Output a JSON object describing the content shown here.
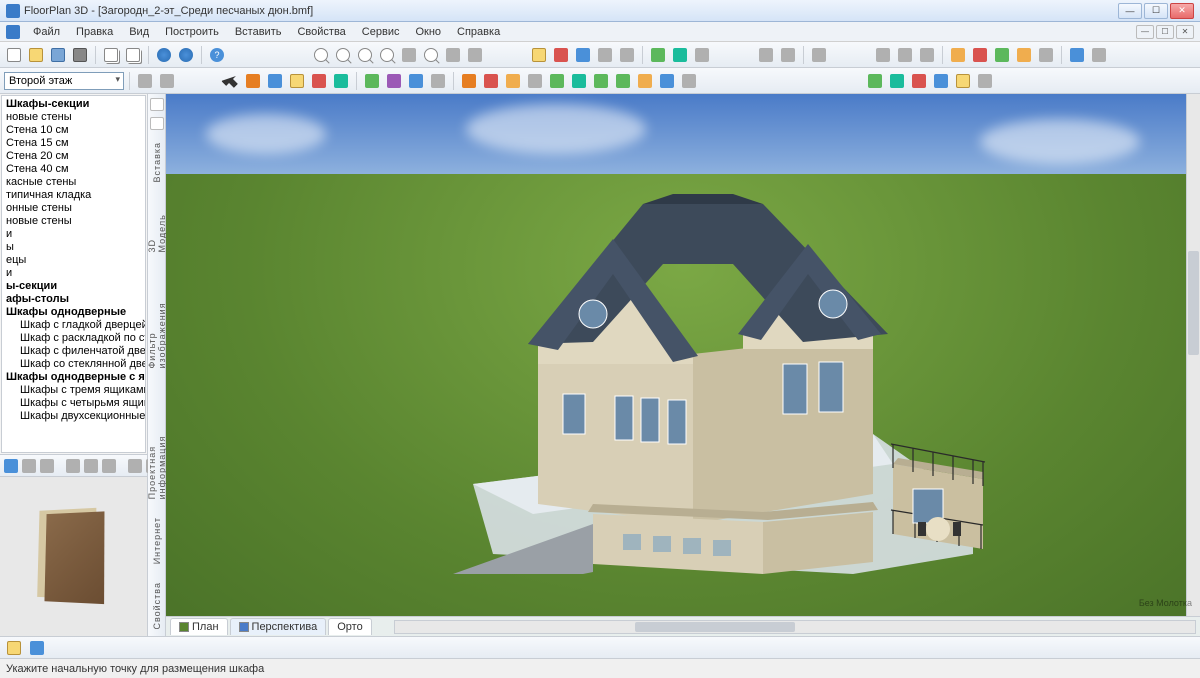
{
  "titlebar": {
    "title": "FloorPlan 3D - [Загородн_2-эт_Среди песчаных дюн.bmf]"
  },
  "menu": {
    "items": [
      "Файл",
      "Правка",
      "Вид",
      "Построить",
      "Вставить",
      "Свойства",
      "Сервис",
      "Окно",
      "Справка"
    ]
  },
  "floor_selector": {
    "value": "Второй этаж"
  },
  "sidebar_tree": {
    "items": [
      "Шкафы-секции",
      "новые стены",
      "Стена 10 см",
      "Стена 15 см",
      "Стена 20 см",
      "Стена 40 см",
      "касные стены",
      "типичная кладка",
      "онные стены",
      "новые стены",
      "и",
      "ы",
      "ецы",
      "и",
      "ы-секции",
      "афы-столы",
      "Шкафы однодверные",
      "Шкаф с гладкой дверцей",
      "Шкаф с раскладкой по стеклу",
      "Шкаф с филенчатой дверцей",
      "Шкаф со стеклянной дверцей",
      "Шкафы однодверные с ящиком",
      "Шкафы с тремя ящиками",
      "Шкафы с четырьмя ящиками",
      "Шкафы двухсекционные"
    ],
    "bold_indices": [
      0,
      14,
      15,
      16,
      21
    ],
    "sub_indices": [
      17,
      18,
      19,
      20,
      22,
      23,
      24
    ]
  },
  "vertical_rail": {
    "labels": [
      "Вставка",
      "3D Модель",
      "Фильтр изображения",
      "Проектная информация",
      "Интернет",
      "Свойства"
    ]
  },
  "view_tabs": {
    "items": [
      "План",
      "Перспектива",
      "Орто"
    ],
    "active_index": 1
  },
  "statusbar": {
    "text": "Укажите начальную точку для размещения шкафа"
  },
  "watermark": "Без Молотка"
}
